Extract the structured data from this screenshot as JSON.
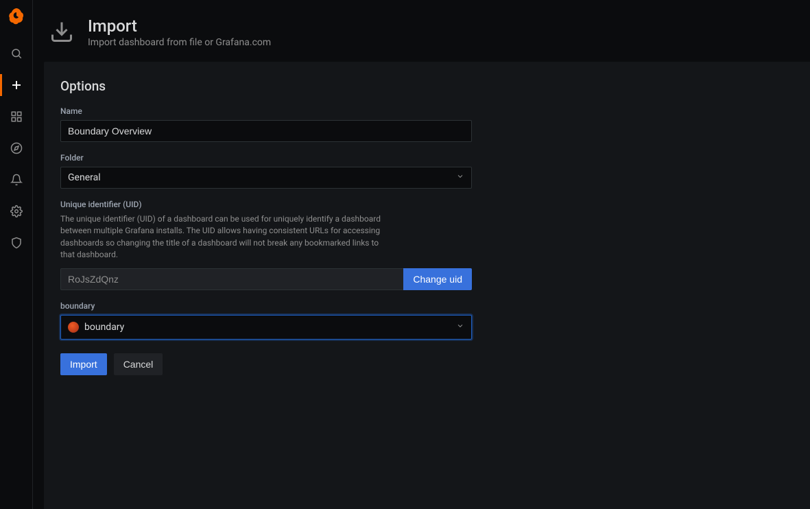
{
  "header": {
    "title": "Import",
    "subtitle": "Import dashboard from file or Grafana.com"
  },
  "section_title": "Options",
  "form": {
    "name_label": "Name",
    "name_value": "Boundary Overview",
    "folder_label": "Folder",
    "folder_value": "General",
    "uid_label": "Unique identifier (UID)",
    "uid_desc": "The unique identifier (UID) of a dashboard can be used for uniquely identify a dashboard between multiple Grafana installs. The UID allows having consistent URLs for accessing dashboards so changing the title of a dashboard will not break any bookmarked links to that dashboard.",
    "uid_value": "RoJsZdQnz",
    "uid_button": "Change uid",
    "datasource_label": "boundary",
    "datasource_value": "boundary"
  },
  "buttons": {
    "import": "Import",
    "cancel": "Cancel"
  },
  "sidebar": {
    "items": [
      "search",
      "create",
      "dashboards",
      "explore",
      "alerting",
      "configuration",
      "admin"
    ]
  }
}
